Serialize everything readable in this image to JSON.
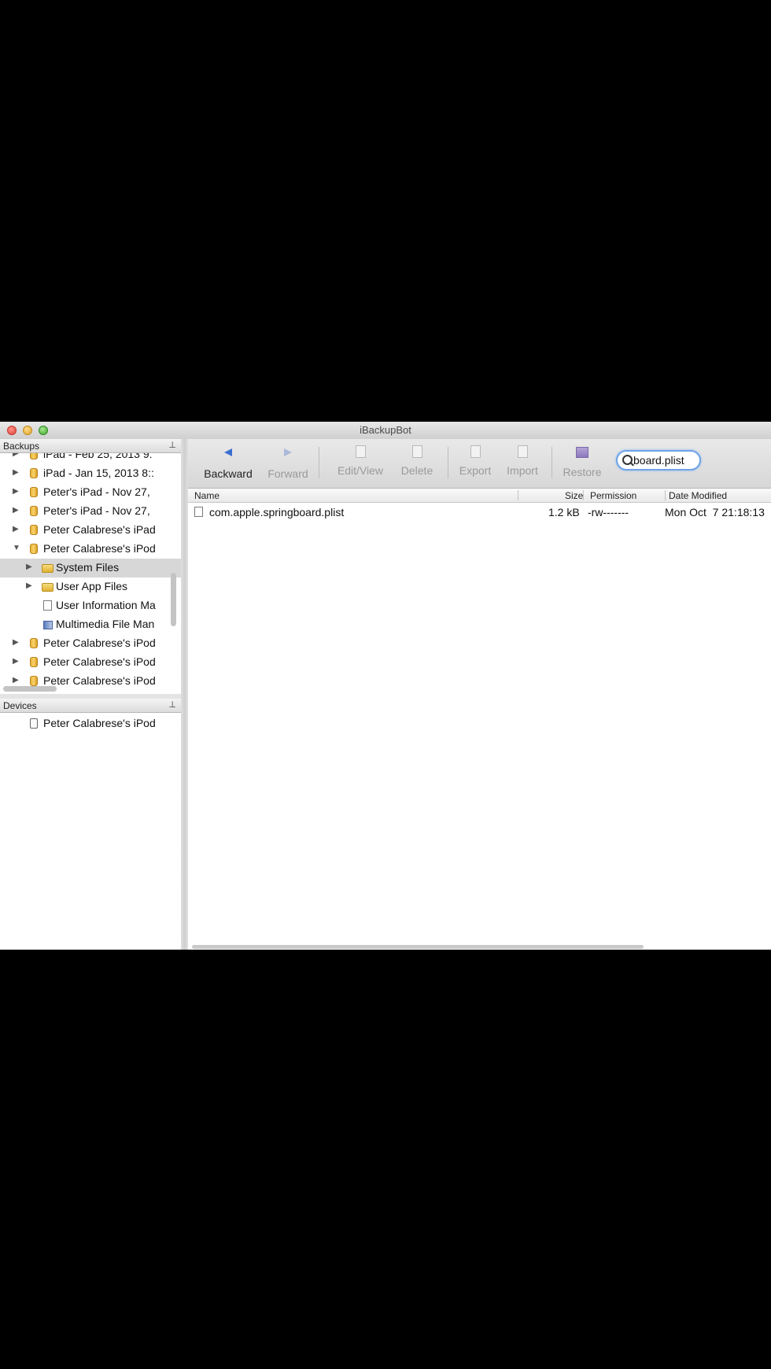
{
  "window": {
    "title": "iBackupBot"
  },
  "backups_pane": {
    "header": "Backups",
    "items": [
      {
        "label": "iPad - Feb 25, 2013 9:",
        "disclosure": "▶",
        "icon": "backup-cylinder-icon"
      },
      {
        "label": "iPad - Jan 15, 2013 8::",
        "disclosure": "▶",
        "icon": "backup-cylinder-icon"
      },
      {
        "label": "Peter's iPad - Nov 27,",
        "disclosure": "▶",
        "icon": "backup-cylinder-icon"
      },
      {
        "label": "Peter's iPad - Nov 27,",
        "disclosure": "▶",
        "icon": "backup-cylinder-icon"
      },
      {
        "label": "Peter Calabrese's iPad",
        "disclosure": "▶",
        "icon": "backup-cylinder-icon"
      },
      {
        "label": "Peter Calabrese's iPod",
        "disclosure": "▼",
        "icon": "backup-cylinder-icon"
      },
      {
        "label": "System Files",
        "disclosure": "▶",
        "icon": "folder-icon"
      },
      {
        "label": "User App Files",
        "disclosure": "▶",
        "icon": "folder-icon"
      },
      {
        "label": "User Information Ma",
        "disclosure": "",
        "icon": "user-info-icon"
      },
      {
        "label": "Multimedia File Man",
        "disclosure": "",
        "icon": "multimedia-icon"
      },
      {
        "label": "Peter Calabrese's iPod",
        "disclosure": "▶",
        "icon": "backup-cylinder-icon"
      },
      {
        "label": "Peter Calabrese's iPod",
        "disclosure": "▶",
        "icon": "backup-cylinder-icon"
      },
      {
        "label": "Peter Calabrese's iPod",
        "disclosure": "▶",
        "icon": "backup-cylinder-icon"
      }
    ]
  },
  "devices_pane": {
    "header": "Devices",
    "items": [
      {
        "label": "Peter Calabrese's iPod",
        "icon": "ipod-icon"
      }
    ]
  },
  "toolbar": {
    "backward": "Backward",
    "forward": "Forward",
    "edit_view": "Edit/View",
    "delete": "Delete",
    "export": "Export",
    "import": "Import",
    "restore": "Restore",
    "search_value": "board.plist"
  },
  "file_list": {
    "columns": {
      "name": "Name",
      "size": "Size",
      "permission": "Permission",
      "date_modified": "Date Modified"
    },
    "rows": [
      {
        "name": "com.apple.springboard.plist",
        "size": "1.2 kB",
        "permission": "-rw-------",
        "date_modified": "Mon Oct  7 21:18:13"
      }
    ]
  },
  "pin_glyph": "⊥"
}
